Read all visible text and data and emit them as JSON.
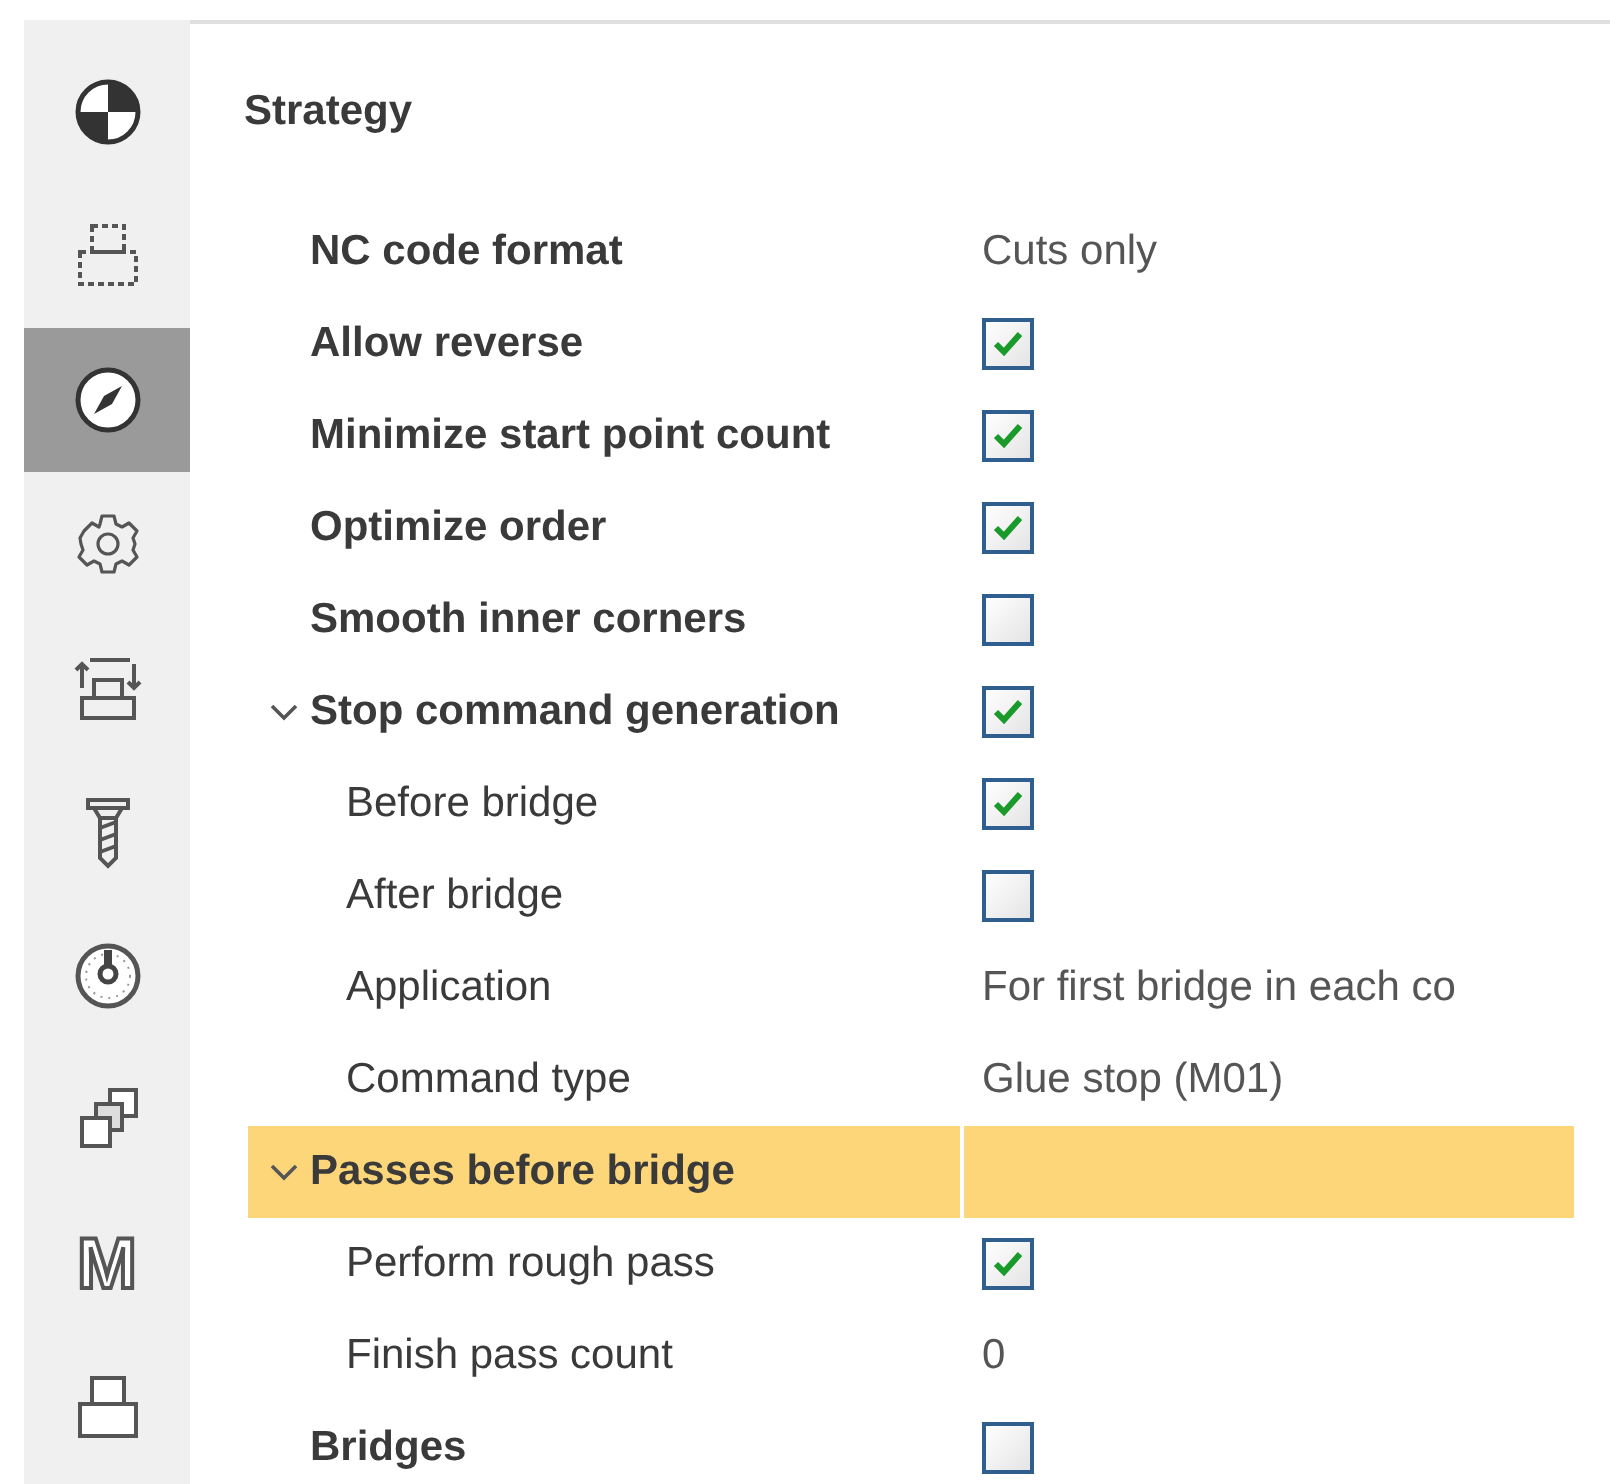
{
  "sidebar": {
    "items": [
      {
        "selected": false
      },
      {
        "selected": false
      },
      {
        "selected": true
      },
      {
        "selected": false
      },
      {
        "selected": false
      },
      {
        "selected": false
      },
      {
        "selected": false
      },
      {
        "selected": false
      },
      {
        "selected": false,
        "glyph": "M"
      },
      {
        "selected": false
      }
    ]
  },
  "section": {
    "title": "Strategy"
  },
  "rows": [
    {
      "label": "NC code format",
      "kind": "text",
      "value": "Cuts only",
      "selected": false
    },
    {
      "label": "Allow reverse",
      "kind": "checkbox",
      "checked": true,
      "selected": false
    },
    {
      "label": "Minimize start point count",
      "kind": "checkbox",
      "checked": true,
      "selected": false
    },
    {
      "label": "Optimize order",
      "kind": "checkbox",
      "checked": true,
      "selected": false
    },
    {
      "label": "Smooth inner corners",
      "kind": "checkbox",
      "checked": false,
      "selected": false
    },
    {
      "label": "Stop command generation",
      "kind": "checkbox",
      "checked": true,
      "selected": false,
      "expanded": true,
      "children": [
        {
          "label": "Before bridge",
          "kind": "checkbox",
          "checked": true,
          "selected": false
        },
        {
          "label": "After bridge",
          "kind": "checkbox",
          "checked": false,
          "selected": false
        },
        {
          "label": "Application",
          "kind": "text",
          "value": "For first bridge in each co",
          "selected": false
        },
        {
          "label": "Command type",
          "kind": "text",
          "value": "Glue stop (M01)",
          "selected": false
        }
      ]
    },
    {
      "label": "Passes before bridge",
      "kind": "group",
      "selected": true,
      "expanded": true,
      "children": [
        {
          "label": "Perform rough pass",
          "kind": "checkbox",
          "checked": true,
          "selected": false
        },
        {
          "label": "Finish pass count",
          "kind": "text",
          "value": "0",
          "selected": false
        }
      ]
    },
    {
      "label": "Bridges",
      "kind": "checkbox",
      "checked": false,
      "selected": false
    }
  ]
}
